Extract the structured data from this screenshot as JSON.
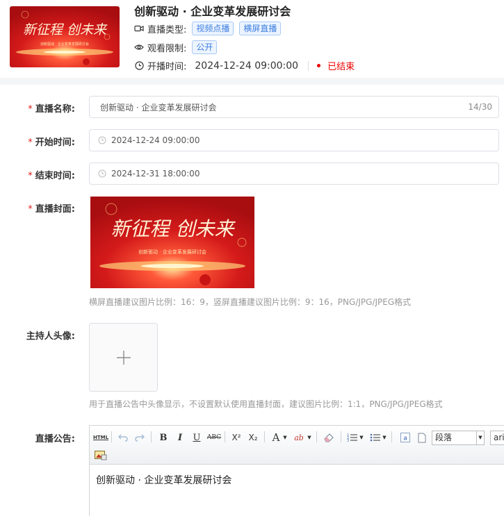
{
  "header": {
    "title": "创新驱动 · 企业变革发展研讨会",
    "type_label": "直播类型:",
    "type_tags": [
      "视频点播",
      "横屏直播"
    ],
    "view_label": "观看限制:",
    "view_tag": "公开",
    "time_label": "开播时间:",
    "time_value": "2024-12-24 09:00:00",
    "status": "已结束"
  },
  "cover_art": {
    "headline": "新征程 创未来",
    "subline": "创新驱动 · 企业变革发展研讨会"
  },
  "form": {
    "name": {
      "label": "直播名称:",
      "value": "创新驱动 · 企业变革发展研讨会",
      "count": "14/30"
    },
    "start": {
      "label": "开始时间:",
      "value": "2024-12-24 09:00:00"
    },
    "end": {
      "label": "结束时间:",
      "value": "2024-12-31 18:00:00"
    },
    "cover": {
      "label": "直播封面:",
      "hint": "横屏直播建议图片比例：16：9，竖屏直播建议图片比例：9：16，PNG/JPG/JPEG格式"
    },
    "host": {
      "label": "主持人头像:",
      "hint": "用于直播公告中头像显示，不设置默认使用直播封面，建议图片比例：1:1，PNG/JPG/JPEG格式"
    },
    "notice": {
      "label": "直播公告:"
    }
  },
  "editor": {
    "toolbar": {
      "html": "HTML",
      "bold": "B",
      "italic": "I",
      "underline": "U",
      "strike": "ABC",
      "sup": "X²",
      "sub": "X₂",
      "fontcolor": "A",
      "highlight": "ab",
      "paragraph": "段落",
      "font": "arial"
    },
    "content": "创新驱动 · 企业变革发展研讨会"
  },
  "colors": {
    "accent": "#3d7fe0",
    "danger": "#e00000",
    "required": "#e02020"
  }
}
